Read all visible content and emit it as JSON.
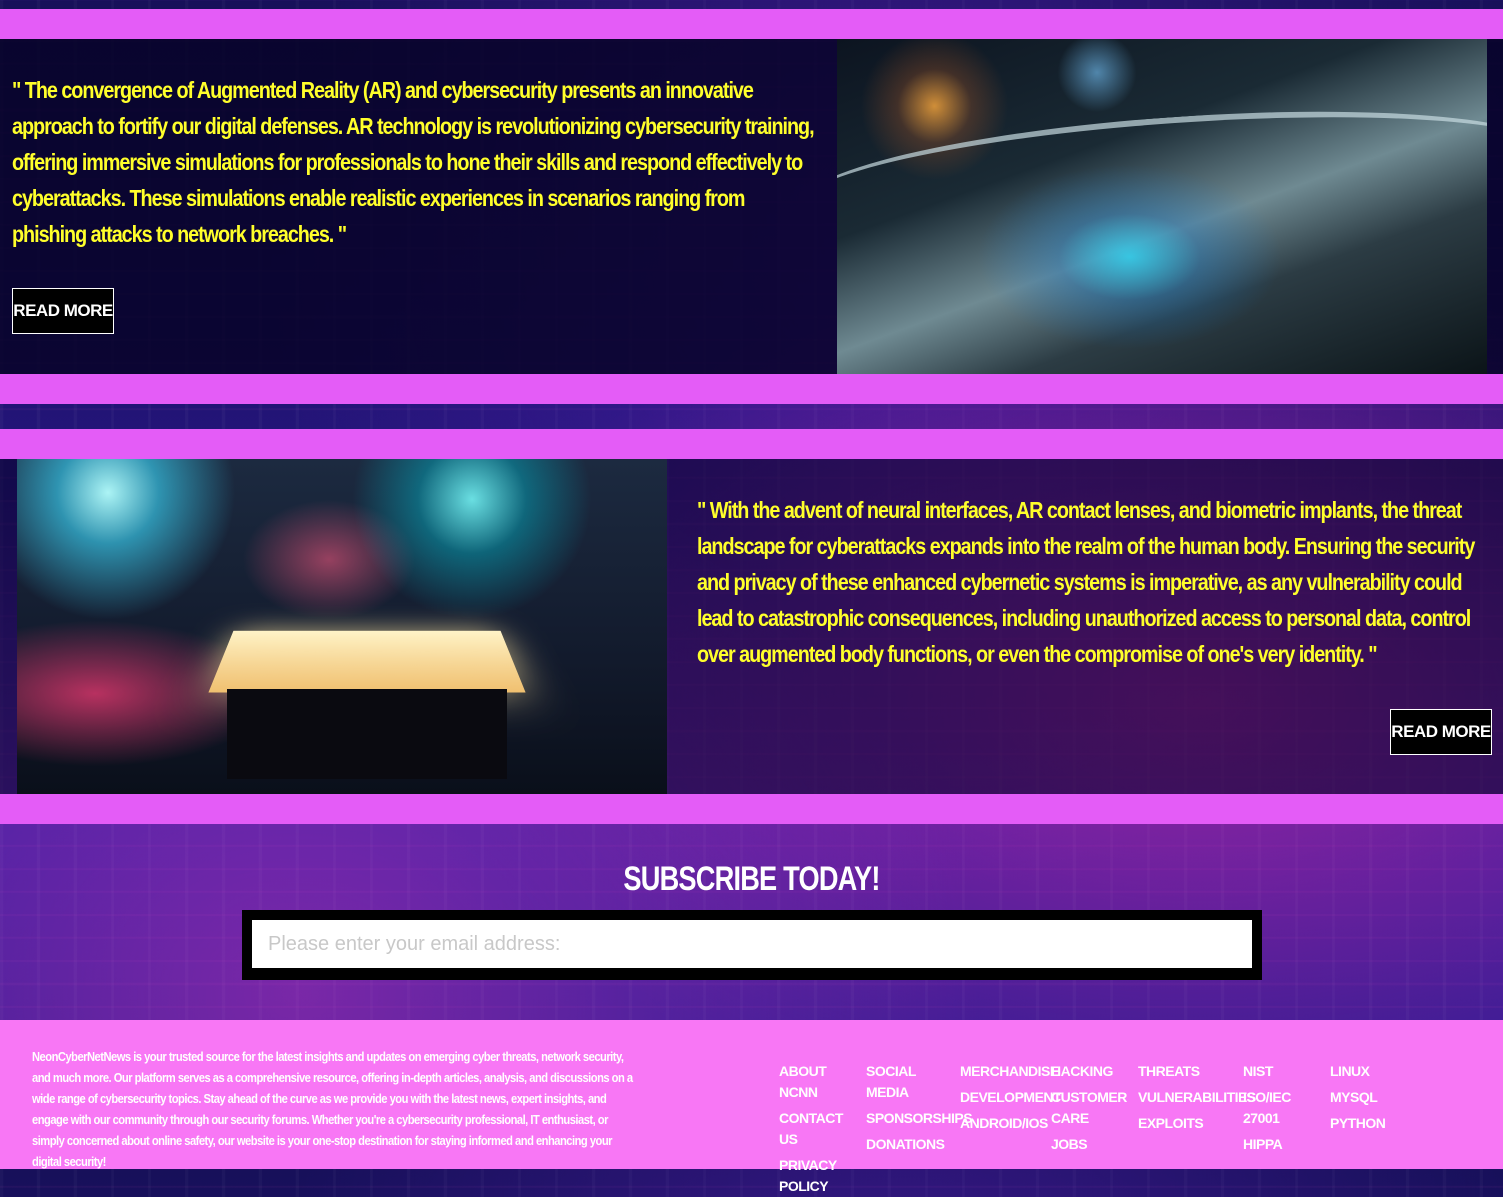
{
  "article1": {
    "quote": "\" The convergence of Augmented Reality (AR) and cybersecurity presents an innovative approach to fortify our digital defenses. AR technology is revolutionizing cybersecurity training, offering immersive simulations for professionals to hone their skills and respond effectively to cyberattacks. These simulations enable realistic experiences in scenarios ranging from phishing attacks to network breaches. \"",
    "button": "READ MORE"
  },
  "article2": {
    "quote": "\" With the advent of neural interfaces, AR contact lenses, and biometric implants, the threat landscape for cyberattacks expands into the realm of the human body. Ensuring the security and privacy of these enhanced cybernetic systems is imperative, as any vulnerability could lead to catastrophic consequences, including unauthorized access to personal data, control over augmented body functions, or even the compromise of one's very identity. \"",
    "button": "READ MORE"
  },
  "subscribe": {
    "title": "SUBSCRIBE TODAY!",
    "placeholder": "Please enter your email address:"
  },
  "footer": {
    "about": "NeonCyberNetNews is your trusted source for the latest insights and updates on emerging cyber threats, network security, and much more. Our platform serves as a comprehensive resource, offering in-depth articles, analysis, and discussions on a wide range of cybersecurity topics. Stay ahead of the curve as we provide you with the latest news, expert insights, and engage with our community through our security forums. Whether you're a cybersecurity professional, IT enthusiast, or simply concerned about online safety, our website is your one-stop destination for staying informed and enhancing your digital security!",
    "columns": [
      [
        "ABOUT NCNN",
        "CONTACT US",
        "PRIVACY POLICY"
      ],
      [
        "SOCIAL MEDIA",
        "SPONSORSHIPS",
        "DONATIONS"
      ],
      [
        "MERCHANDISE",
        "DEVELOPMENT",
        "ANDROID/IOS"
      ],
      [
        "HACKING",
        "CUSTOMER CARE",
        "JOBS"
      ],
      [
        "THREATS",
        "VULNERABILITIES",
        "EXPLOITS"
      ],
      [
        "NIST",
        "ISO/IEC 27001",
        "HIPPA"
      ],
      [
        "LINUX",
        "MYSQL",
        "PYTHON"
      ]
    ]
  },
  "colors": {
    "band": "#e45cf7",
    "quote_text": "#ffff2b",
    "footer_bg": "#f877f5"
  }
}
